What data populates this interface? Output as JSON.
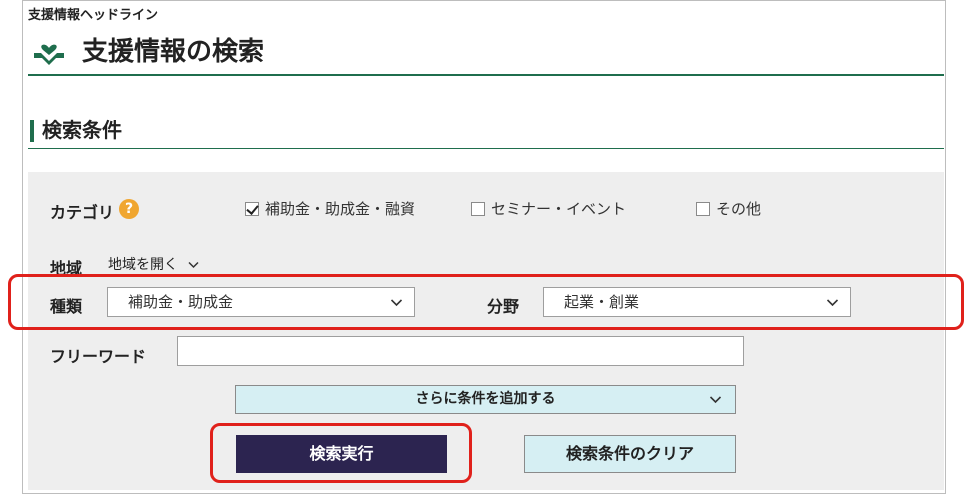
{
  "header": {
    "headline": "支援情報ヘッドライン",
    "page_title": "支援情報の検索",
    "accent_color": "#1f6e4d"
  },
  "section": {
    "title": "検索条件"
  },
  "filters": {
    "category_label": "カテゴリ",
    "help_glyph": "?",
    "category_options": [
      {
        "label": "補助金・助成金・融資",
        "checked": true
      },
      {
        "label": "セミナー・イベント",
        "checked": false
      },
      {
        "label": "その他",
        "checked": false
      }
    ],
    "region_label": "地域",
    "region_toggle": "地域を開く",
    "type_label": "種類",
    "type_value": "補助金・助成金",
    "field_label": "分野",
    "field_value": "起業・創業",
    "freeword_label": "フリーワード",
    "freeword_value": ""
  },
  "actions": {
    "add_conditions": "さらに条件を追加する",
    "search": "検索実行",
    "clear": "検索条件のクリア"
  },
  "colors": {
    "highlight": "#e0211b",
    "search_button": "#2c2450",
    "light_button": "#d6eff3"
  }
}
